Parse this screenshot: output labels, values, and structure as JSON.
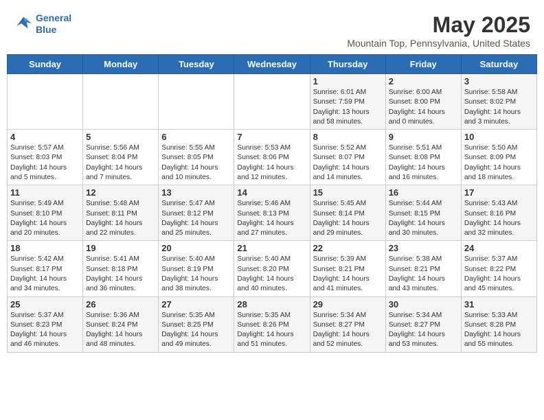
{
  "header": {
    "logo_line1": "General",
    "logo_line2": "Blue",
    "title": "May 2025",
    "subtitle": "Mountain Top, Pennsylvania, United States"
  },
  "weekdays": [
    "Sunday",
    "Monday",
    "Tuesday",
    "Wednesday",
    "Thursday",
    "Friday",
    "Saturday"
  ],
  "weeks": [
    [
      {
        "day": "",
        "content": ""
      },
      {
        "day": "",
        "content": ""
      },
      {
        "day": "",
        "content": ""
      },
      {
        "day": "",
        "content": ""
      },
      {
        "day": "1",
        "content": "Sunrise: 6:01 AM\nSunset: 7:59 PM\nDaylight: 13 hours\nand 58 minutes."
      },
      {
        "day": "2",
        "content": "Sunrise: 6:00 AM\nSunset: 8:00 PM\nDaylight: 14 hours\nand 0 minutes."
      },
      {
        "day": "3",
        "content": "Sunrise: 5:58 AM\nSunset: 8:02 PM\nDaylight: 14 hours\nand 3 minutes."
      }
    ],
    [
      {
        "day": "4",
        "content": "Sunrise: 5:57 AM\nSunset: 8:03 PM\nDaylight: 14 hours\nand 5 minutes."
      },
      {
        "day": "5",
        "content": "Sunrise: 5:56 AM\nSunset: 8:04 PM\nDaylight: 14 hours\nand 7 minutes."
      },
      {
        "day": "6",
        "content": "Sunrise: 5:55 AM\nSunset: 8:05 PM\nDaylight: 14 hours\nand 10 minutes."
      },
      {
        "day": "7",
        "content": "Sunrise: 5:53 AM\nSunset: 8:06 PM\nDaylight: 14 hours\nand 12 minutes."
      },
      {
        "day": "8",
        "content": "Sunrise: 5:52 AM\nSunset: 8:07 PM\nDaylight: 14 hours\nand 14 minutes."
      },
      {
        "day": "9",
        "content": "Sunrise: 5:51 AM\nSunset: 8:08 PM\nDaylight: 14 hours\nand 16 minutes."
      },
      {
        "day": "10",
        "content": "Sunrise: 5:50 AM\nSunset: 8:09 PM\nDaylight: 14 hours\nand 18 minutes."
      }
    ],
    [
      {
        "day": "11",
        "content": "Sunrise: 5:49 AM\nSunset: 8:10 PM\nDaylight: 14 hours\nand 20 minutes."
      },
      {
        "day": "12",
        "content": "Sunrise: 5:48 AM\nSunset: 8:11 PM\nDaylight: 14 hours\nand 22 minutes."
      },
      {
        "day": "13",
        "content": "Sunrise: 5:47 AM\nSunset: 8:12 PM\nDaylight: 14 hours\nand 25 minutes."
      },
      {
        "day": "14",
        "content": "Sunrise: 5:46 AM\nSunset: 8:13 PM\nDaylight: 14 hours\nand 27 minutes."
      },
      {
        "day": "15",
        "content": "Sunrise: 5:45 AM\nSunset: 8:14 PM\nDaylight: 14 hours\nand 29 minutes."
      },
      {
        "day": "16",
        "content": "Sunrise: 5:44 AM\nSunset: 8:15 PM\nDaylight: 14 hours\nand 30 minutes."
      },
      {
        "day": "17",
        "content": "Sunrise: 5:43 AM\nSunset: 8:16 PM\nDaylight: 14 hours\nand 32 minutes."
      }
    ],
    [
      {
        "day": "18",
        "content": "Sunrise: 5:42 AM\nSunset: 8:17 PM\nDaylight: 14 hours\nand 34 minutes."
      },
      {
        "day": "19",
        "content": "Sunrise: 5:41 AM\nSunset: 8:18 PM\nDaylight: 14 hours\nand 36 minutes."
      },
      {
        "day": "20",
        "content": "Sunrise: 5:40 AM\nSunset: 8:19 PM\nDaylight: 14 hours\nand 38 minutes."
      },
      {
        "day": "21",
        "content": "Sunrise: 5:40 AM\nSunset: 8:20 PM\nDaylight: 14 hours\nand 40 minutes."
      },
      {
        "day": "22",
        "content": "Sunrise: 5:39 AM\nSunset: 8:21 PM\nDaylight: 14 hours\nand 41 minutes."
      },
      {
        "day": "23",
        "content": "Sunrise: 5:38 AM\nSunset: 8:21 PM\nDaylight: 14 hours\nand 43 minutes."
      },
      {
        "day": "24",
        "content": "Sunrise: 5:37 AM\nSunset: 8:22 PM\nDaylight: 14 hours\nand 45 minutes."
      }
    ],
    [
      {
        "day": "25",
        "content": "Sunrise: 5:37 AM\nSunset: 8:23 PM\nDaylight: 14 hours\nand 46 minutes."
      },
      {
        "day": "26",
        "content": "Sunrise: 5:36 AM\nSunset: 8:24 PM\nDaylight: 14 hours\nand 48 minutes."
      },
      {
        "day": "27",
        "content": "Sunrise: 5:35 AM\nSunset: 8:25 PM\nDaylight: 14 hours\nand 49 minutes."
      },
      {
        "day": "28",
        "content": "Sunrise: 5:35 AM\nSunset: 8:26 PM\nDaylight: 14 hours\nand 51 minutes."
      },
      {
        "day": "29",
        "content": "Sunrise: 5:34 AM\nSunset: 8:27 PM\nDaylight: 14 hours\nand 52 minutes."
      },
      {
        "day": "30",
        "content": "Sunrise: 5:34 AM\nSunset: 8:27 PM\nDaylight: 14 hours\nand 53 minutes."
      },
      {
        "day": "31",
        "content": "Sunrise: 5:33 AM\nSunset: 8:28 PM\nDaylight: 14 hours\nand 55 minutes."
      }
    ]
  ]
}
